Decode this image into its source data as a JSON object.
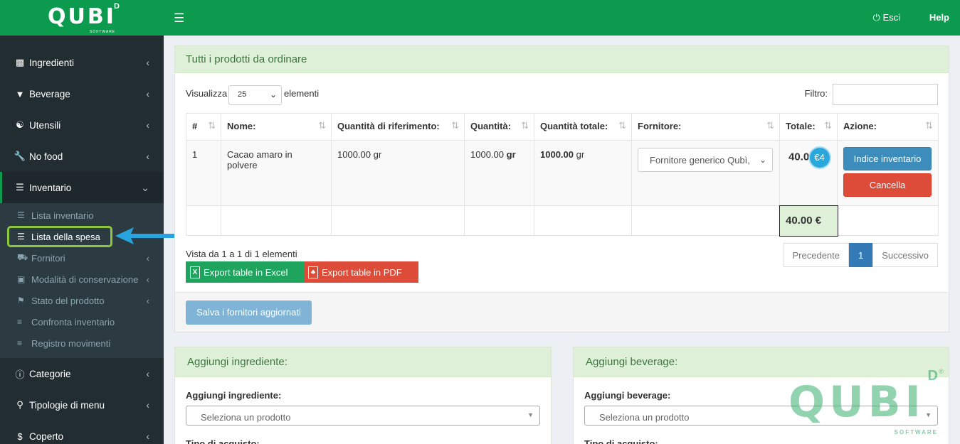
{
  "brand": {
    "logo": "QUBI",
    "logo_sub": "SOFTWARE",
    "logo_d": "D",
    "accent": "#0c9b4e"
  },
  "header": {
    "menu_icon": "hamburger-icon",
    "logout_label": "Esci",
    "help_label": "Help"
  },
  "sidebar": {
    "items": [
      {
        "label": "Ingredienti",
        "icon": "puzzle-icon"
      },
      {
        "label": "Beverage",
        "icon": "filter-icon"
      },
      {
        "label": "Utensili",
        "icon": "utensils-icon"
      },
      {
        "label": "No food",
        "icon": "wrench-icon"
      },
      {
        "label": "Inventario",
        "icon": "list-icon"
      }
    ],
    "submenu": [
      {
        "label": "Lista inventario"
      },
      {
        "label": "Lista della spesa"
      },
      {
        "label": "Fornitori"
      },
      {
        "label": "Modalità di conservazione"
      },
      {
        "label": "Stato del prodotto"
      },
      {
        "label": "Confronta inventario"
      },
      {
        "label": "Registro movimenti"
      }
    ],
    "items_after": [
      {
        "label": "Categorie",
        "icon": "info-icon"
      },
      {
        "label": "Tipologie di menu",
        "icon": "pin-icon"
      },
      {
        "label": "Coperto",
        "icon": "dollar-icon"
      }
    ]
  },
  "main": {
    "title": "Tutti i prodotti da ordinare",
    "show_label": "Visualizza",
    "page_size": "25",
    "elements_label": "elementi",
    "filter_label": "Filtro:",
    "columns": [
      "#",
      "Nome:",
      "Quantità di riferimento:",
      "Quantità:",
      "Quantità totale:",
      "Fornitore:",
      "Totale:",
      "Azione:"
    ],
    "rows": [
      {
        "index": "1",
        "name": "Cacao amaro in polvere",
        "ref_qty": "1000.00 gr",
        "qty_value": "1000.00",
        "qty_unit": "gr",
        "total_qty_value": "1000.00",
        "total_qty_unit": "gr",
        "supplier": "Fornitore generico Qubì,",
        "total": "40.00",
        "badge": "€4",
        "btn_inventory": "Indice inventario",
        "btn_delete": "Cancella"
      }
    ],
    "grand_total": "40.00 €",
    "info": "Vista da 1 a 1 di 1 elementi",
    "export_excel": "Export table in Excel",
    "export_pdf": "Export table in PDF",
    "pagination": {
      "prev": "Precedente",
      "current": "1",
      "next": "Successivo"
    },
    "save_label": "Salva i fornitori aggiornati"
  },
  "add_ingredient": {
    "title": "Aggiungi ingrediente:",
    "field_label": "Aggiungi ingrediente:",
    "placeholder": "Seleziona un prodotto",
    "type_label": "Tipo di acquisto:"
  },
  "add_beverage": {
    "title": "Aggiungi beverage:",
    "field_label": "Aggiungi beverage:",
    "placeholder": "Seleziona un prodotto",
    "type_label": "Tipo di acquisto:"
  },
  "watermark": {
    "text": "QUBI",
    "sub": "SOFTWARE",
    "mark": "D",
    "reg": "®"
  }
}
